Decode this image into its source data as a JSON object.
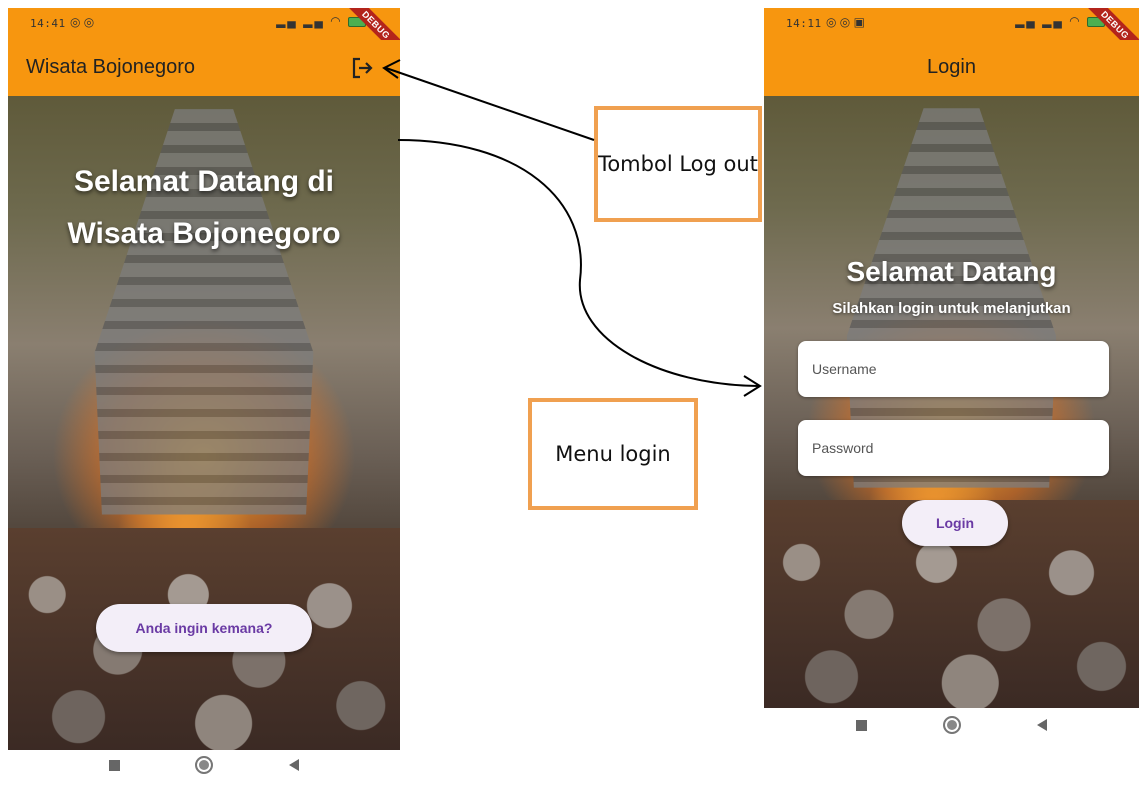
{
  "home_screen": {
    "status_time": "14:41",
    "debug_label": "DEBUG",
    "app_title": "Wisata Bojonegoro",
    "logout_icon": "logout-icon",
    "welcome_text": "Selamat Datang di Wisata Bojonegoro",
    "action_button": "Anda ingin kemana?"
  },
  "login_screen": {
    "status_time": "14:11",
    "debug_label": "DEBUG",
    "app_title": "Login",
    "welcome_title": "Selamat Datang",
    "subtitle": "Silahkan login untuk melanjutkan",
    "username_placeholder": "Username",
    "password_placeholder": "Password",
    "login_button": "Login"
  },
  "annotations": {
    "logout_note": "Tombol Log out",
    "login_note": "Menu login"
  },
  "colors": {
    "app_bar": "#f7960f",
    "button_text": "#6a3aa4",
    "annotation_border": "#f0a050"
  }
}
